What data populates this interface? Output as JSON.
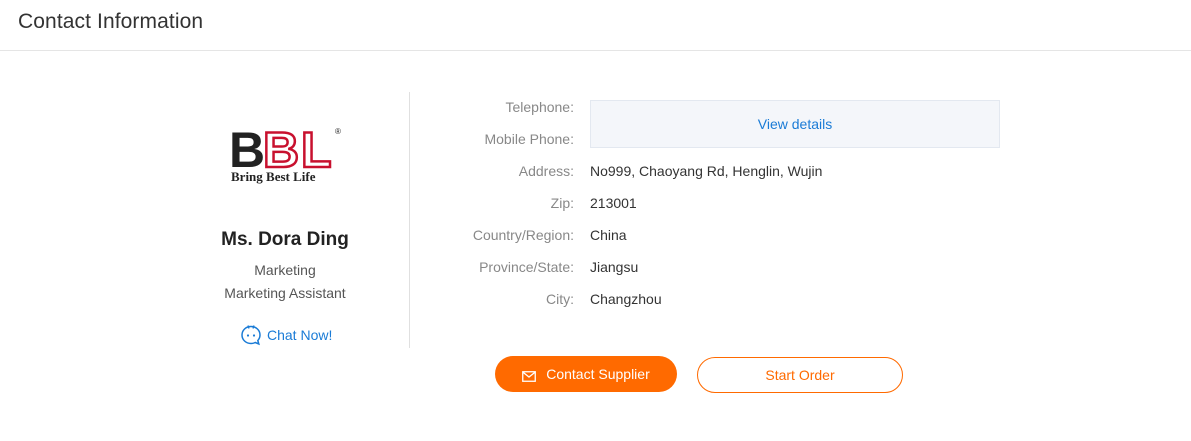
{
  "header": {
    "title": "Contact Information"
  },
  "profile": {
    "logo": {
      "letters": "BBL",
      "registered": "®",
      "tagline": "Bring Best Life"
    },
    "name": "Ms. Dora Ding",
    "department": "Marketing",
    "job_title": "Marketing Assistant",
    "chat_label": "Chat Now!"
  },
  "details": {
    "telephone_label": "Telephone:",
    "mobile_label": "Mobile Phone:",
    "view_details_label": "View details",
    "rows": [
      {
        "label": "Address:",
        "value": "No999, Chaoyang Rd, Henglin, Wujin"
      },
      {
        "label": "Zip:",
        "value": "213001"
      },
      {
        "label": "Country/Region:",
        "value": "China"
      },
      {
        "label": "Province/State:",
        "value": "Jiangsu"
      },
      {
        "label": "City:",
        "value": "Changzhou"
      }
    ]
  },
  "actions": {
    "contact_supplier": "Contact Supplier",
    "start_order": "Start Order"
  },
  "colors": {
    "accent": "#ff6a00",
    "link": "#1a7bd6",
    "logo_dark": "#222222",
    "logo_red": "#c8102e"
  },
  "icons": {
    "chat": "chat-bubble-icon",
    "mail": "mail-icon"
  }
}
